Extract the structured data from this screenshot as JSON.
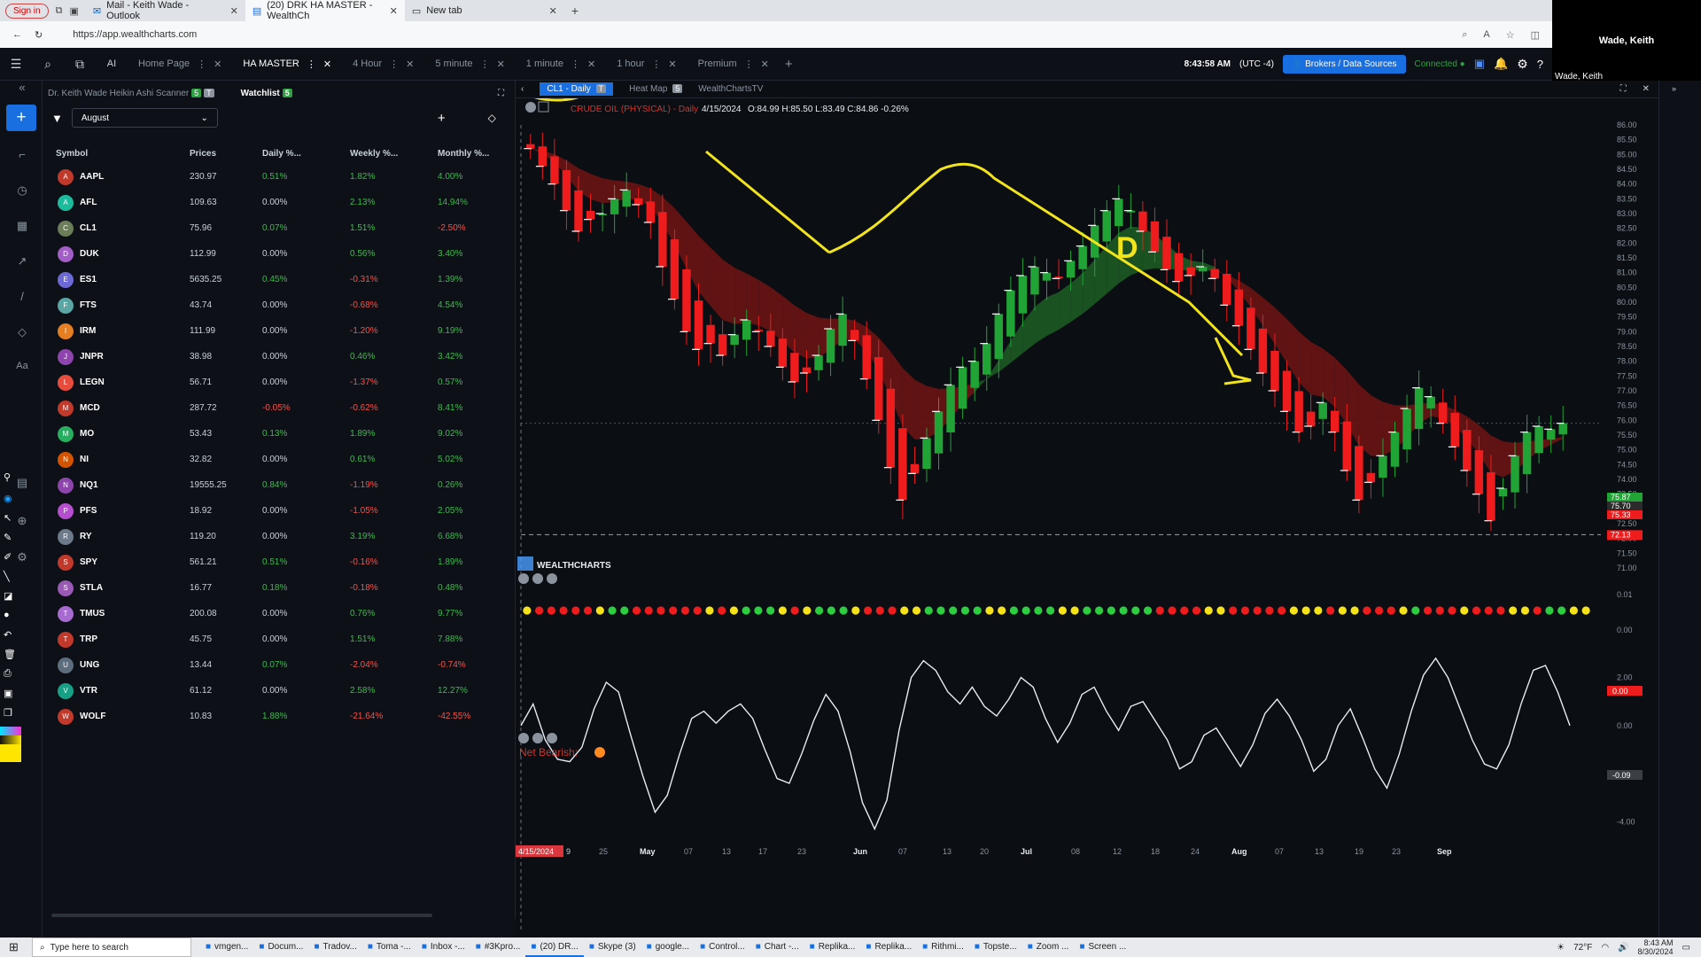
{
  "browser": {
    "signin": "Sign in",
    "tabs": [
      {
        "label": "Mail - Keith Wade - Outlook"
      },
      {
        "label": "(20) DRK HA MASTER - WealthCh"
      },
      {
        "label": "New tab"
      }
    ],
    "url": "https://app.wealthcharts.com"
  },
  "video": {
    "name": "Wade, Keith",
    "caption": "Wade, Keith"
  },
  "header": {
    "tabs": [
      {
        "label": "Home Page"
      },
      {
        "label": "HA MASTER"
      },
      {
        "label": "4 Hour"
      },
      {
        "label": "5 minute"
      },
      {
        "label": "1 minute"
      },
      {
        "label": "1 hour"
      },
      {
        "label": "Premium"
      }
    ],
    "time": "8:43:58 AM",
    "timezone": "(UTC -4)",
    "brokers": "Brokers / Data Sources",
    "connected": "Connected"
  },
  "watchlist": {
    "scanner_tab": "Dr. Keith Wade Heikin Ashi Scanner",
    "scanner_badge": "5",
    "scanner_badge2": "T",
    "watch_tab": "Watchlist",
    "watch_badge": "5",
    "list_name": "August",
    "columns": [
      "Symbol",
      "Prices",
      "Daily %...",
      "Weekly %...",
      "Monthly %..."
    ],
    "rows": [
      {
        "letter": "A",
        "symbol": "AAPL",
        "price": "230.97",
        "daily": "0.51%",
        "weekly": "1.82%",
        "monthly": "4.00%"
      },
      {
        "letter": "A",
        "symbol": "AFL",
        "price": "109.63",
        "daily": "0.00%",
        "weekly": "2.13%",
        "monthly": "14.94%"
      },
      {
        "letter": "C",
        "symbol": "CL1",
        "price": "75.96",
        "daily": "0.07%",
        "weekly": "1.51%",
        "monthly": "-2.50%"
      },
      {
        "letter": "D",
        "symbol": "DUK",
        "price": "112.99",
        "daily": "0.00%",
        "weekly": "0.56%",
        "monthly": "3.40%"
      },
      {
        "letter": "E",
        "symbol": "ES1",
        "price": "5635.25",
        "daily": "0.45%",
        "weekly": "-0.31%",
        "monthly": "1.39%"
      },
      {
        "letter": "F",
        "symbol": "FTS",
        "price": "43.74",
        "daily": "0.00%",
        "weekly": "-0.68%",
        "monthly": "4.54%"
      },
      {
        "letter": "I",
        "symbol": "IRM",
        "price": "111.99",
        "daily": "0.00%",
        "weekly": "-1.20%",
        "monthly": "9.19%"
      },
      {
        "letter": "J",
        "symbol": "JNPR",
        "price": "38.98",
        "daily": "0.00%",
        "weekly": "0.46%",
        "monthly": "3.42%"
      },
      {
        "letter": "L",
        "symbol": "LEGN",
        "price": "56.71",
        "daily": "0.00%",
        "weekly": "-1.37%",
        "monthly": "0.57%"
      },
      {
        "letter": "M",
        "symbol": "MCD",
        "price": "287.72",
        "daily": "-0.05%",
        "weekly": "-0.62%",
        "monthly": "8.41%"
      },
      {
        "letter": "M",
        "symbol": "MO",
        "price": "53.43",
        "daily": "0.13%",
        "weekly": "1.89%",
        "monthly": "9.02%"
      },
      {
        "letter": "N",
        "symbol": "NI",
        "price": "32.82",
        "daily": "0.00%",
        "weekly": "0.61%",
        "monthly": "5.02%"
      },
      {
        "letter": "N",
        "symbol": "NQ1",
        "price": "19555.25",
        "daily": "0.84%",
        "weekly": "-1.19%",
        "monthly": "0.26%"
      },
      {
        "letter": "P",
        "symbol": "PFS",
        "price": "18.92",
        "daily": "0.00%",
        "weekly": "-1.05%",
        "monthly": "2.05%"
      },
      {
        "letter": "R",
        "symbol": "RY",
        "price": "119.20",
        "daily": "0.00%",
        "weekly": "3.19%",
        "monthly": "6.68%"
      },
      {
        "letter": "S",
        "symbol": "SPY",
        "price": "561.21",
        "daily": "0.51%",
        "weekly": "-0.16%",
        "monthly": "1.89%"
      },
      {
        "letter": "S",
        "symbol": "STLA",
        "price": "16.77",
        "daily": "0.18%",
        "weekly": "-0.18%",
        "monthly": "0.48%"
      },
      {
        "letter": "T",
        "symbol": "TMUS",
        "price": "200.08",
        "daily": "0.00%",
        "weekly": "0.76%",
        "monthly": "9.77%"
      },
      {
        "letter": "T",
        "symbol": "TRP",
        "price": "45.75",
        "daily": "0.00%",
        "weekly": "1.51%",
        "monthly": "7.88%"
      },
      {
        "letter": "U",
        "symbol": "UNG",
        "price": "13.44",
        "daily": "0.07%",
        "weekly": "-2.04%",
        "monthly": "-0.74%"
      },
      {
        "letter": "V",
        "symbol": "VTR",
        "price": "61.12",
        "daily": "0.00%",
        "weekly": "2.58%",
        "monthly": "12.27%"
      },
      {
        "letter": "W",
        "symbol": "WOLF",
        "price": "10.83",
        "daily": "1.88%",
        "weekly": "-21.64%",
        "monthly": "-42.55%"
      }
    ]
  },
  "chart_tabs": [
    {
      "label": "CL1 - Daily"
    },
    {
      "label": "Heat Map"
    },
    {
      "label": "WealthChartsTV"
    }
  ],
  "chart_tab_badges": {
    "daily": "T",
    "heat": "5"
  },
  "chart": {
    "legend": "CRUDE OIL (PHYSICAL) - Daily",
    "date": "4/15/2024",
    "ohlc": "O:84.99 H:85.50 L:83.49 C:84.86 -0.26%",
    "brand": "WEALTHCHARTS",
    "osc_label": "Net Bearish:",
    "dot_last": "0.00",
    "osc_last": "-0.09",
    "price_tags": [
      "75.87",
      "75.70",
      "75.33"
    ],
    "support_tag": "72.13",
    "annotation_d": "D"
  },
  "chart_data": {
    "type": "candlestick",
    "y_ticks": [
      "86.00",
      "85.50",
      "85.00",
      "84.50",
      "84.00",
      "83.50",
      "83.00",
      "82.50",
      "82.00",
      "81.50",
      "81.00",
      "80.50",
      "80.00",
      "79.50",
      "79.00",
      "78.50",
      "78.00",
      "77.50",
      "77.00",
      "76.50",
      "76.00",
      "75.50",
      "75.00",
      "74.50",
      "74.00",
      "73.50",
      "73.00",
      "72.50",
      "72.00",
      "71.50",
      "71.00"
    ],
    "ylim": [
      71.0,
      86.0
    ],
    "dot_ticks": [
      "0.01",
      "0.00"
    ],
    "osc_ticks": [
      "2.00",
      "0.00",
      "-2.00",
      "-4.00"
    ],
    "x_ticks": [
      "25",
      "May",
      "07",
      "13",
      "17",
      "23",
      "Jun",
      "07",
      "13",
      "20",
      "Jul",
      "08",
      "12",
      "18",
      "24",
      "Aug",
      "07",
      "13",
      "19",
      "23",
      "Sep"
    ],
    "x_first": "4/15/2024",
    "x_first_suffix": "9",
    "support_level": 72.13,
    "closes": [
      85.2,
      84.6,
      84.0,
      83.1,
      82.4,
      82.8,
      83.0,
      83.5,
      83.8,
      83.3,
      82.7,
      81.2,
      80.1,
      79.0,
      78.4,
      78.6,
      78.2,
      78.9,
      79.4,
      79.0,
      78.5,
      77.8,
      77.3,
      77.6,
      78.2,
      79.1,
      79.6,
      78.7,
      77.4,
      76.0,
      74.4,
      73.3,
      74.2,
      75.4,
      76.3,
      77.2,
      77.8,
      78.0,
      78.6,
      79.6,
      80.4,
      80.9,
      81.2,
      81.0,
      80.8,
      81.4,
      81.9,
      82.6,
      83.1,
      83.5,
      83.1,
      82.4,
      81.7,
      81.1,
      80.7,
      80.9,
      81.2,
      80.8,
      79.9,
      79.2,
      78.4,
      77.6,
      77.0,
      76.3,
      75.6,
      75.8,
      76.6,
      75.6,
      74.3,
      73.3,
      73.9,
      74.8,
      75.6,
      76.4,
      77.1,
      76.8,
      75.9,
      75.1,
      74.3,
      73.5,
      72.6,
      73.7,
      74.8,
      75.6,
      75.8,
      75.7,
      75.9
    ],
    "dots": [
      "y",
      "r",
      "r",
      "r",
      "r",
      "r",
      "y",
      "g",
      "g",
      "r",
      "r",
      "r",
      "r",
      "r",
      "r",
      "y",
      "r",
      "y",
      "g",
      "g",
      "g",
      "y",
      "r",
      "y",
      "g",
      "g",
      "g",
      "y",
      "r",
      "r",
      "r",
      "y",
      "y",
      "g",
      "g",
      "g",
      "g",
      "g",
      "y",
      "y",
      "g",
      "g",
      "g",
      "g",
      "y",
      "y",
      "g",
      "g",
      "g",
      "g",
      "g",
      "g",
      "r",
      "r",
      "r",
      "r",
      "y",
      "y",
      "r",
      "r",
      "r",
      "r",
      "r",
      "y",
      "y",
      "y",
      "r",
      "y",
      "y",
      "r",
      "r",
      "r",
      "y",
      "g",
      "r",
      "r",
      "r",
      "y",
      "r",
      "r",
      "r",
      "y",
      "y",
      "r",
      "g",
      "g",
      "y",
      "y"
    ],
    "osc": [
      0.0,
      0.9,
      -0.6,
      -1.4,
      -1.5,
      -0.9,
      0.7,
      1.8,
      1.4,
      -0.4,
      -2.1,
      -3.6,
      -2.9,
      -1.2,
      0.3,
      0.6,
      0.1,
      0.6,
      0.9,
      0.3,
      -1.0,
      -2.2,
      -2.4,
      -1.2,
      0.2,
      1.3,
      0.6,
      -1.1,
      -3.2,
      -4.3,
      -3.1,
      -0.2,
      2.0,
      2.7,
      2.3,
      1.4,
      0.9,
      1.6,
      0.8,
      0.4,
      1.1,
      2.0,
      1.6,
      0.3,
      -0.7,
      0.1,
      1.3,
      1.6,
      0.6,
      -0.2,
      0.8,
      1.0,
      0.2,
      -0.6,
      -1.8,
      -1.5,
      -0.4,
      -0.1,
      -0.9,
      -1.7,
      -0.8,
      0.5,
      1.1,
      0.4,
      -0.6,
      -1.9,
      -1.4,
      0.0,
      0.7,
      -0.5,
      -1.8,
      -2.6,
      -1.2,
      0.6,
      2.1,
      2.8,
      2.0,
      0.7,
      -0.6,
      -1.6,
      -1.8,
      -0.8,
      0.9,
      2.3,
      2.5,
      1.4,
      0.0
    ]
  },
  "taskbar": {
    "search": "Type here to search",
    "items": [
      {
        "label": "vmgen..."
      },
      {
        "label": "Docum..."
      },
      {
        "label": "Tradov..."
      },
      {
        "label": "Toma -..."
      },
      {
        "label": "Inbox -..."
      },
      {
        "label": "#3Kpro..."
      },
      {
        "label": "(20) DR..."
      },
      {
        "label": "Skype (3)"
      },
      {
        "label": "google..."
      },
      {
        "label": "Control..."
      },
      {
        "label": "Chart -..."
      },
      {
        "label": "Replika..."
      },
      {
        "label": "Replika..."
      },
      {
        "label": "Rithmi..."
      },
      {
        "label": "Topste..."
      },
      {
        "label": "Zoom ..."
      },
      {
        "label": "Screen ..."
      }
    ],
    "temp": "72°F",
    "clock_time": "8:43 AM",
    "clock_date": "8/30/2024"
  },
  "colors": {
    "accent": "#1a6fe0",
    "up": "#21a336",
    "down": "#ee1c1c",
    "annotation": "#f2e41c"
  }
}
